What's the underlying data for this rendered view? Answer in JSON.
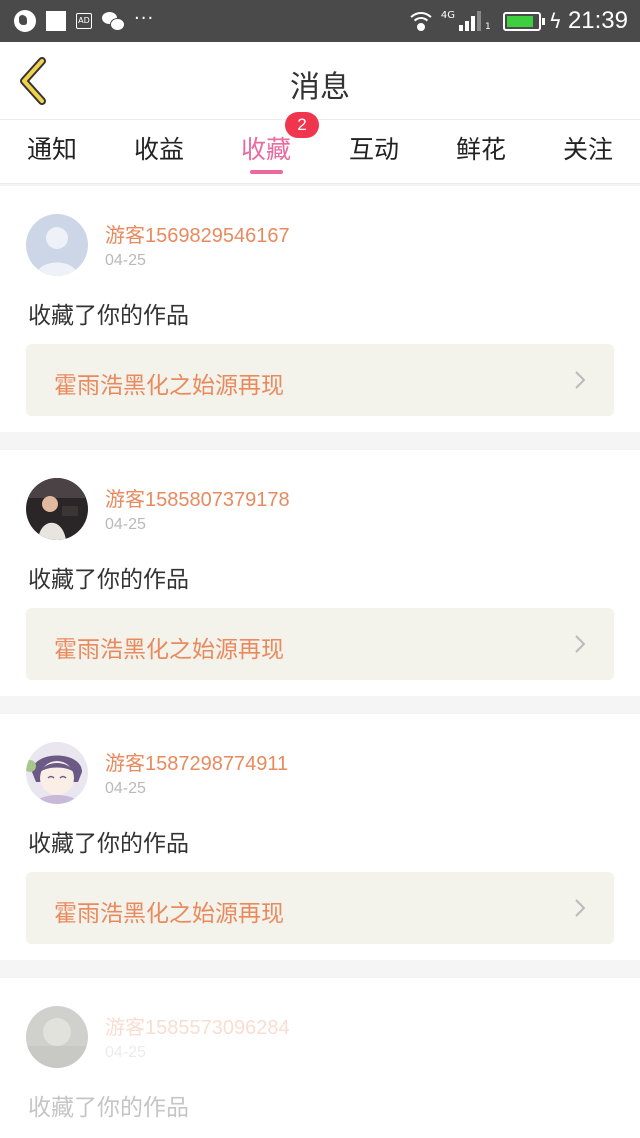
{
  "status_bar": {
    "ad_label": "AD",
    "more": "···",
    "network": "4G",
    "sim": "1",
    "battery_level": 0.85,
    "time": "21:39"
  },
  "header": {
    "title": "消息",
    "back_icon": "chevron-left-icon"
  },
  "tabs": {
    "items": [
      {
        "label": "通知"
      },
      {
        "label": "收益"
      },
      {
        "label": "收藏"
      },
      {
        "label": "互动"
      },
      {
        "label": "鲜花"
      },
      {
        "label": "关注"
      }
    ],
    "active_index": 2,
    "badge": "2",
    "accent_color": "#e96a9f",
    "badge_color": "#f0364e"
  },
  "messages": [
    {
      "username": "游客1569829546167",
      "date": "04-25",
      "action": "收藏了你的作品",
      "work": "霍雨浩黑化之始源再现"
    },
    {
      "username": "游客1585807379178",
      "date": "04-25",
      "action": "收藏了你的作品",
      "work": "霍雨浩黑化之始源再现"
    },
    {
      "username": "游客1587298774911",
      "date": "04-25",
      "action": "收藏了你的作品",
      "work": "霍雨浩黑化之始源再现"
    },
    {
      "username": "游客1585573096284",
      "date": "04-25",
      "action": "收藏了你的作品",
      "work": ""
    }
  ],
  "colors": {
    "username": "#e88a5e",
    "work_box_bg": "#f3f3ec"
  }
}
